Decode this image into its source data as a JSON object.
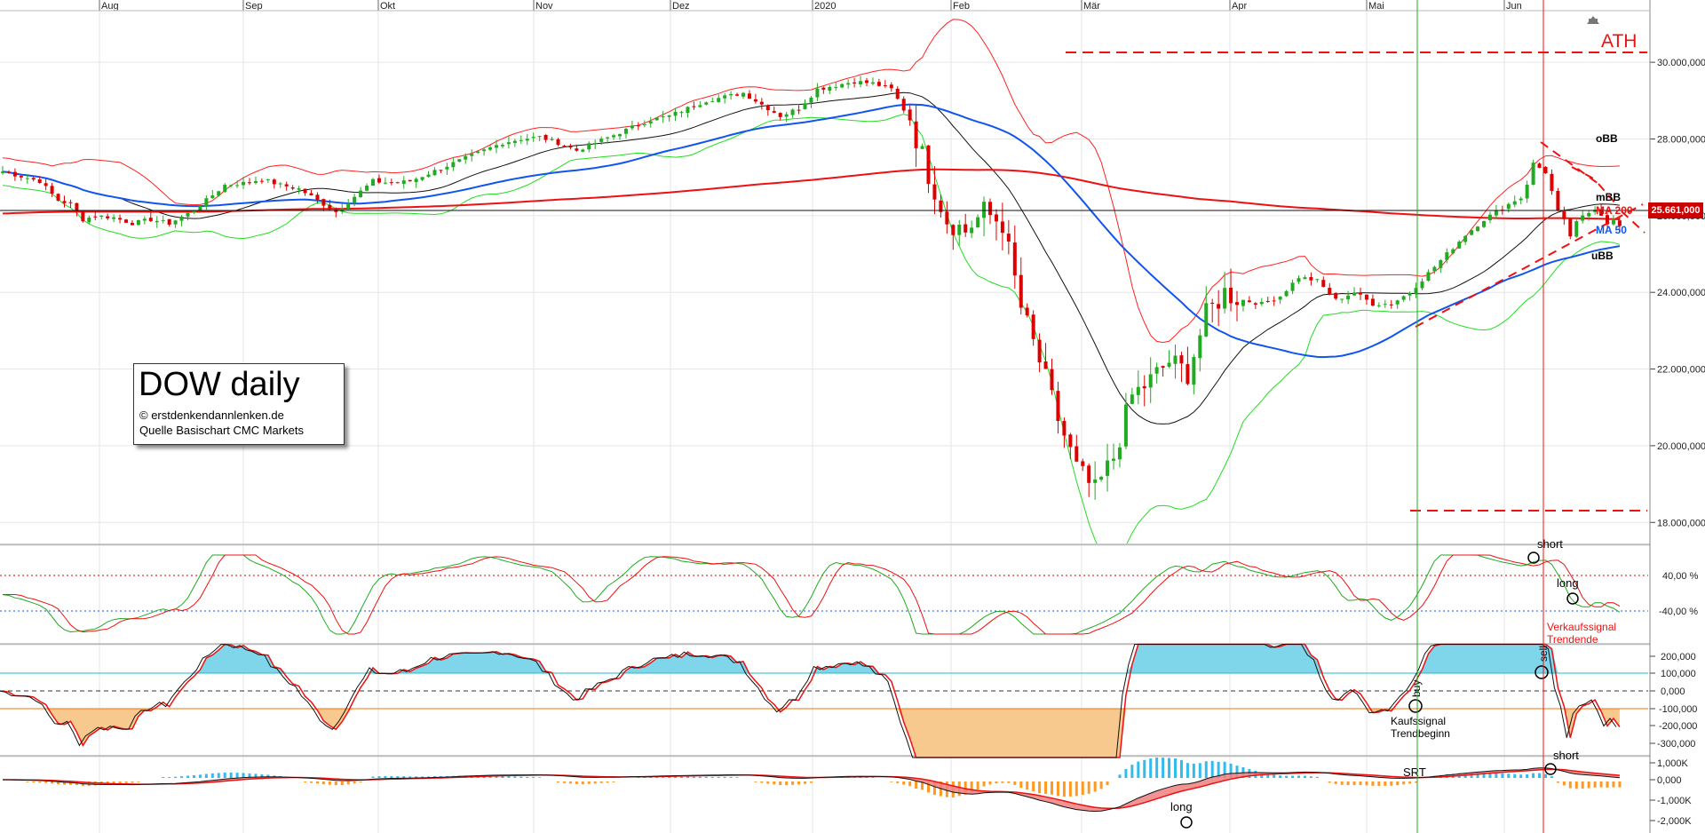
{
  "chart_data": [
    {
      "type": "candlestick",
      "title": "DOW daily",
      "months": [
        "Aug",
        "Sep",
        "Okt",
        "Nov",
        "Dez",
        "2020",
        "Feb",
        "Mär",
        "Apr",
        "Mai",
        "Jun"
      ],
      "y_ticks": [
        "30.000,000",
        "28.000,000",
        "26.000,000",
        "24.000,000",
        "22.000,000",
        "20.000,000",
        "18.000,000"
      ],
      "y_tick_values": [
        30000,
        28000,
        26000,
        24000,
        22000,
        20000,
        18000
      ],
      "ylim": [
        17450,
        31300
      ],
      "last_price": "25.661,000",
      "last_price_value": 25661,
      "ath_label": "ATH",
      "ath_value": 29550,
      "support_value": 18200,
      "labels": {
        "obb": "oBB",
        "mbb": "mBB",
        "ma200": "MA 200",
        "ma50": "MA 50",
        "ubb": "uBB"
      },
      "colors": {
        "up": "#22aa22",
        "down": "#dd0000",
        "ma200": "#ee1111",
        "ma50": "#1155ee",
        "mbb": "#111111",
        "obb": "#ff2222",
        "ubb": "#22dd22"
      },
      "close_anchors": [
        [
          0,
          27150
        ],
        [
          6,
          26900
        ],
        [
          9,
          26400
        ],
        [
          11,
          26300
        ],
        [
          13,
          25900
        ],
        [
          15,
          26000
        ],
        [
          18,
          25950
        ],
        [
          21,
          25800
        ],
        [
          24,
          25900
        ],
        [
          27,
          25800
        ],
        [
          30,
          26050
        ],
        [
          33,
          26400
        ],
        [
          36,
          26800
        ],
        [
          39,
          26850
        ],
        [
          42,
          26950
        ],
        [
          45,
          26800
        ],
        [
          48,
          26700
        ],
        [
          51,
          26400
        ],
        [
          54,
          26100
        ],
        [
          57,
          26500
        ],
        [
          60,
          26900
        ],
        [
          63,
          26850
        ],
        [
          66,
          26900
        ],
        [
          69,
          27100
        ],
        [
          72,
          27300
        ],
        [
          75,
          27500
        ],
        [
          78,
          27700
        ],
        [
          81,
          27900
        ],
        [
          84,
          28000
        ],
        [
          87,
          28050
        ],
        [
          90,
          27900
        ],
        [
          93,
          27700
        ],
        [
          96,
          27900
        ],
        [
          99,
          28100
        ],
        [
          102,
          28300
        ],
        [
          105,
          28500
        ],
        [
          108,
          28600
        ],
        [
          111,
          28800
        ],
        [
          114,
          29000
        ],
        [
          117,
          29100
        ],
        [
          120,
          29200
        ],
        [
          123,
          28900
        ],
        [
          126,
          28600
        ],
        [
          129,
          28800
        ],
        [
          132,
          29300
        ],
        [
          135,
          29400
        ],
        [
          138,
          29500
        ],
        [
          141,
          29450
        ],
        [
          144,
          29300
        ],
        [
          147,
          28500
        ],
        [
          150,
          27100
        ],
        [
          153,
          25900
        ],
        [
          156,
          25600
        ],
        [
          159,
          26100
        ],
        [
          162,
          25800
        ],
        [
          165,
          23600
        ],
        [
          168,
          22200
        ],
        [
          171,
          20700
        ],
        [
          174,
          19400
        ],
        [
          177,
          18800
        ],
        [
          180,
          19700
        ],
        [
          183,
          21300
        ],
        [
          186,
          21700
        ],
        [
          189,
          22200
        ],
        [
          192,
          21900
        ],
        [
          195,
          23400
        ],
        [
          198,
          24000
        ],
        [
          201,
          23800
        ],
        [
          204,
          23700
        ],
        [
          207,
          23900
        ],
        [
          210,
          24400
        ],
        [
          213,
          24300
        ],
        [
          216,
          23800
        ],
        [
          219,
          24000
        ],
        [
          222,
          23700
        ],
        [
          225,
          23700
        ],
        [
          228,
          24000
        ],
        [
          231,
          24500
        ],
        [
          234,
          25000
        ],
        [
          237,
          25500
        ],
        [
          240,
          25900
        ],
        [
          243,
          26200
        ],
        [
          246,
          26500
        ],
        [
          248,
          27300
        ],
        [
          250,
          27200
        ],
        [
          252,
          26000
        ],
        [
          254,
          25500
        ],
        [
          256,
          25900
        ],
        [
          258,
          26300
        ],
        [
          260,
          25900
        ],
        [
          262,
          25700
        ]
      ]
    },
    {
      "type": "line",
      "name": "oscillator",
      "y_ticks": [
        "40,00 %",
        "-40,00 %"
      ],
      "annotations": [
        "short",
        "long",
        "Verkaufssignal",
        "Trendende"
      ]
    },
    {
      "type": "area",
      "name": "momentum",
      "y_ticks": [
        "200,000",
        "100,000",
        "0,000",
        "-100,000",
        "-200,000",
        "-300,000"
      ],
      "annotations": [
        "buy",
        "sell",
        "Kaufssignal",
        "Trendbeginn"
      ]
    },
    {
      "type": "line",
      "name": "macd",
      "y_ticks": [
        "1,000K",
        "0,000",
        "-1,000K",
        "-2,000K"
      ],
      "annotations": [
        "long",
        "SRT",
        "short"
      ]
    }
  ],
  "infobox": {
    "title": "DOW daily",
    "copyright": "© erstdenkendannlenken.de",
    "source": "Quelle Basischart CMC Markets"
  },
  "icons": {
    "corner": "house-icon"
  }
}
